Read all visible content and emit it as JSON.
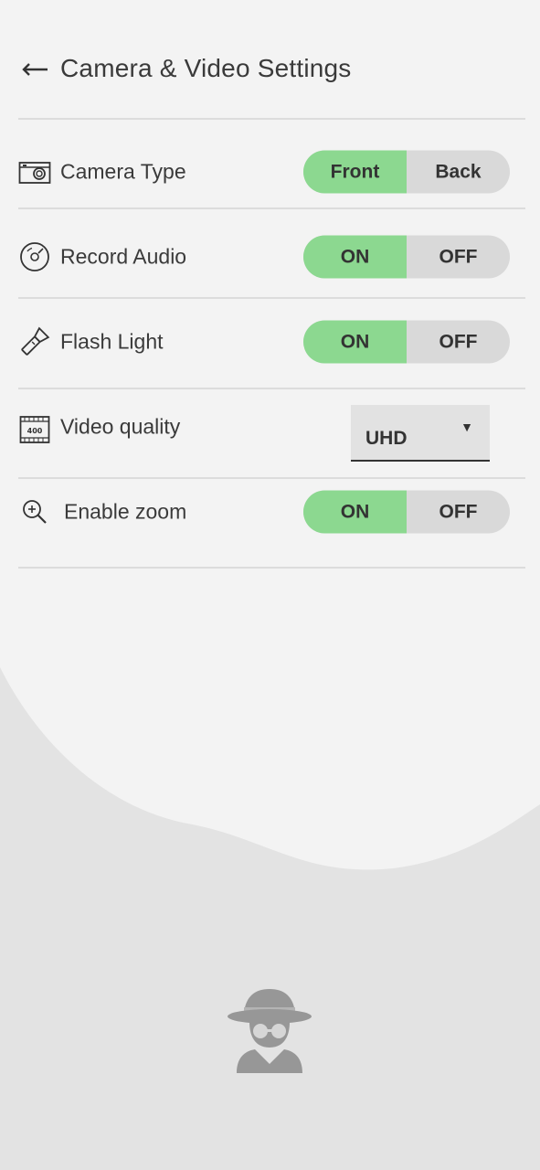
{
  "header": {
    "title": "Camera & Video Settings"
  },
  "settings": {
    "camera_type": {
      "label": "Camera Type",
      "options": [
        "Front",
        "Back"
      ],
      "selected": "Front"
    },
    "record_audio": {
      "label": "Record Audio",
      "options": [
        "ON",
        "OFF"
      ],
      "selected": "ON"
    },
    "flash_light": {
      "label": "Flash Light",
      "options": [
        "ON",
        "OFF"
      ],
      "selected": "ON"
    },
    "video_quality": {
      "label": "Video quality",
      "value": "UHD",
      "icon_text": "400"
    },
    "enable_zoom": {
      "label": "Enable zoom",
      "options": [
        "ON",
        "OFF"
      ],
      "selected": "ON"
    }
  },
  "colors": {
    "active": "#8cd890",
    "inactive": "#d9d9d9",
    "background": "#f3f3f3",
    "wave": "#e3e3e3"
  }
}
